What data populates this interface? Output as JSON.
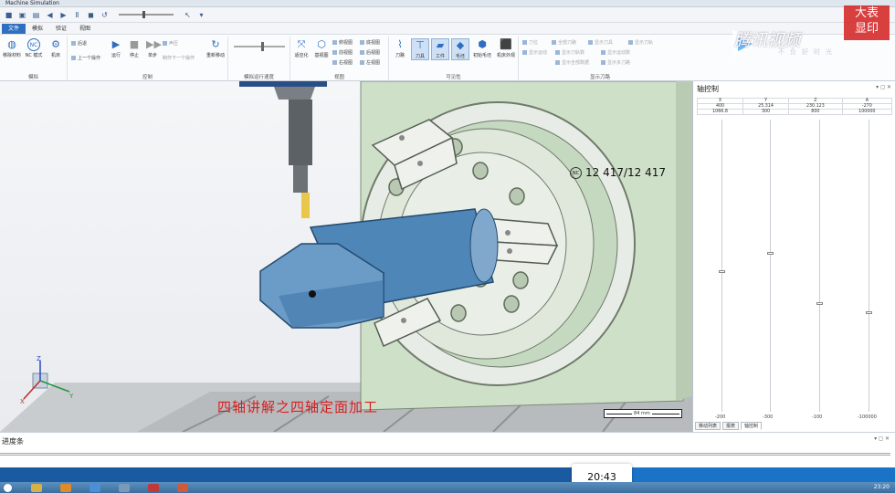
{
  "window": {
    "title": "Machine Simulation"
  },
  "tabs": [
    {
      "label": "文件",
      "active": true
    },
    {
      "label": "模拟"
    },
    {
      "label": "验证"
    },
    {
      "label": "视图"
    }
  ],
  "ribbon": {
    "groups": {
      "sim": "模拟",
      "control": "控制",
      "speed": "模拟运行速度",
      "view": "视图",
      "visibility": "可见性",
      "show_tool": "显示刀路"
    },
    "sim_buttons": [
      "移除材料",
      "NC 模式",
      "机床"
    ],
    "control_small": [
      "后退",
      "上一个操作"
    ],
    "control_buttons": [
      "运行",
      "停止",
      "单步",
      "暂停",
      "制作下一个",
      "重新移动"
    ],
    "control_step": [
      "声压",
      "制作下一个操作"
    ],
    "view_buttons": [
      "适应化",
      "基视图"
    ],
    "view_small": [
      "俯视图",
      "前视图",
      "右视图",
      "底视图",
      "后视图",
      "左视图"
    ],
    "vis_buttons": [
      "刀路",
      "刀具",
      "工件",
      "毛坯",
      "初始毛坯",
      "机床外观"
    ],
    "show_small": [
      "刀位",
      "全部刀路",
      "显示刀具",
      "显示刀轨",
      "显示运动",
      "显示刀轨数",
      "显示运动数",
      "显示全部数据",
      "显示多刀路"
    ]
  },
  "viewport": {
    "nc_icon": "NC",
    "nc_count": "12 417/12 417",
    "subtitle": "四轴讲解之四轴定面加工",
    "scale_label": "84 mm",
    "axes": {
      "x": "X",
      "y": "Y",
      "z": "Z"
    }
  },
  "axis_panel": {
    "title": "轴控制",
    "headers": [
      "X",
      "Y",
      "Z",
      "A"
    ],
    "row1": [
      "400",
      "25.314",
      "230.123",
      "-270"
    ],
    "row2": [
      "1066.8",
      "300",
      "800",
      "100000"
    ],
    "bottom": [
      "-200",
      "-300",
      "-100",
      "-100000"
    ],
    "tabs": [
      "移动列表",
      "报表",
      "轴控制"
    ]
  },
  "progress": {
    "label": "进度条",
    "value": 0.64
  },
  "player": {
    "time": "20:43"
  },
  "taskbar": {
    "clock": "23:20"
  },
  "watermark": {
    "badge": "大表\n显印",
    "brand": "腾讯视频",
    "sub": "不负好时光"
  }
}
